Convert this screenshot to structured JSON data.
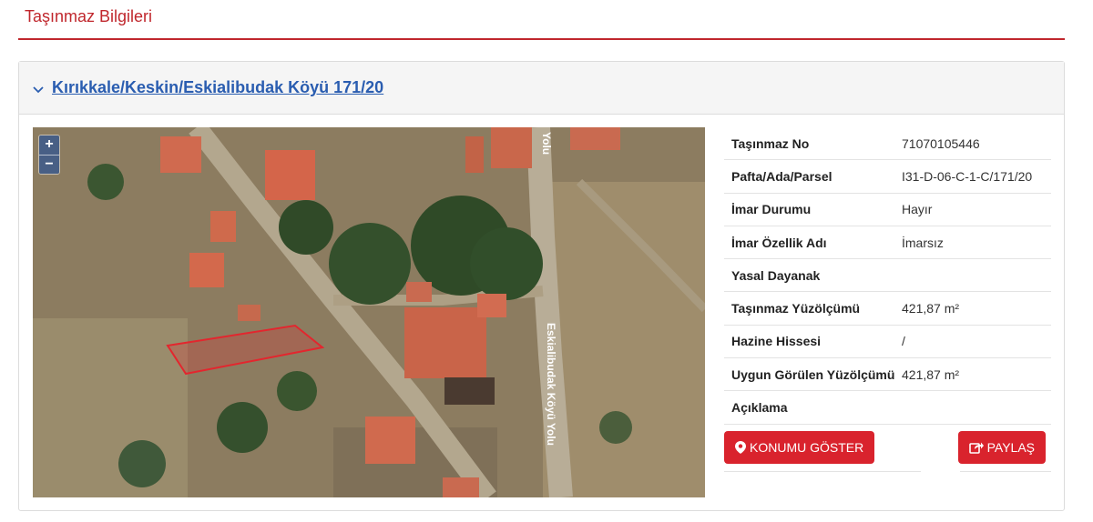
{
  "page": {
    "title": "Taşınmaz Bilgileri"
  },
  "panel": {
    "heading": "Kırıkkale/Keskin/Eskialibudak Köyü 171/20"
  },
  "map": {
    "zoom_in": "+",
    "zoom_out": "−",
    "road_labels": [
      "Yolu",
      "Eskialibudak Köyü Yolu"
    ],
    "parcel_color": "#e3262e"
  },
  "info": {
    "rows": [
      {
        "label": "Taşınmaz No",
        "value": "71070105446"
      },
      {
        "label": "Pafta/Ada/Parsel",
        "value": "I31-D-06-C-1-C/171/20"
      },
      {
        "label": "İmar Durumu",
        "value": "Hayır"
      },
      {
        "label": "İmar Özellik Adı",
        "value": "İmarsız"
      },
      {
        "label": "Yasal Dayanak",
        "value": ""
      },
      {
        "label": "Taşınmaz Yüzölçümü",
        "value": "421,87 m²"
      },
      {
        "label": "Hazine Hissesi",
        "value": "/"
      },
      {
        "label": "Uygun Görülen Yüzölçümü",
        "value": "421,87 m²"
      },
      {
        "label": "Açıklama",
        "value": ""
      }
    ]
  },
  "actions": {
    "show_location": "KONUMU GÖSTER",
    "share": "PAYLAŞ"
  },
  "colors": {
    "accent": "#c0272d",
    "button": "#d9232d",
    "link": "#2a5db0"
  }
}
